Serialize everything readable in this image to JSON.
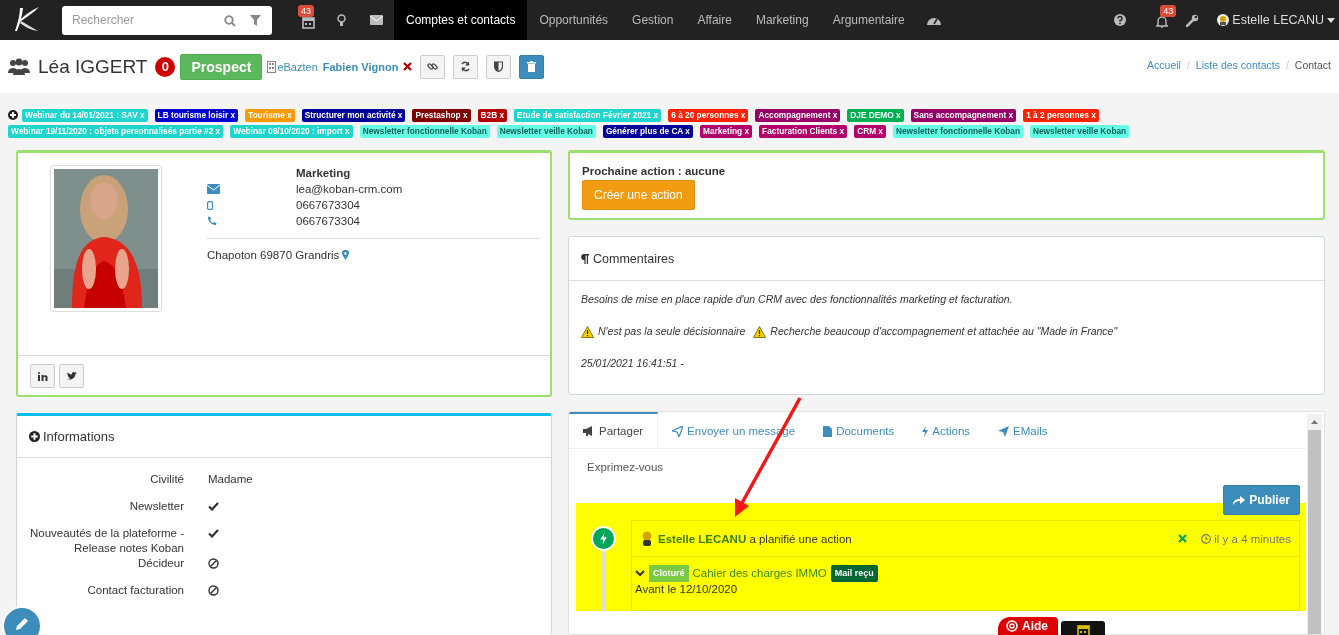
{
  "topbar": {
    "search_placeholder": "Rechercher",
    "calendar_badge": "43",
    "nav": [
      {
        "label": "Comptes et contacts",
        "selected": true
      },
      {
        "label": "Opportunités",
        "selected": false
      },
      {
        "label": "Gestion",
        "selected": false
      },
      {
        "label": "Affaire",
        "selected": false
      },
      {
        "label": "Marketing",
        "selected": false
      },
      {
        "label": "Argumentaire",
        "selected": false
      }
    ],
    "notifications_badge": "43",
    "user": "Estelle LECANU"
  },
  "contact": {
    "name": "Léa IGGERT",
    "score": "0",
    "status": "Prospect",
    "company": "eBazten",
    "owner": "Fabien Vignon"
  },
  "breadcrumb": [
    "Accueil",
    "Liste des contacts",
    "Contact"
  ],
  "breadcrumb_separator": "/",
  "tag_rows": [
    [
      {
        "label": "Webinar du 14/01/2021 : SAV x",
        "color": "#1ed6cb"
      },
      {
        "label": "LB tourisme loisir x",
        "color": "#0000cc"
      },
      {
        "label": "Tourisme x",
        "color": "#ff9900"
      },
      {
        "label": "Structurer mon activité x",
        "color": "#000099"
      },
      {
        "label": "Prestashop x",
        "color": "#800000"
      },
      {
        "label": "B2B x",
        "color": "#b30000"
      },
      {
        "label": "Etude de satisfaction Février 2021 x",
        "color": "#1ed6cb"
      },
      {
        "label": "6 à 20 personnes x",
        "color": "#ff2200"
      },
      {
        "label": "Accompagnement x",
        "color": "#990066"
      },
      {
        "label": "DJE DEMO x",
        "color": "#00b050"
      },
      {
        "label": "Sans accompagnement x",
        "color": "#990066"
      },
      {
        "label": "1 à 2 personnes x",
        "color": "#ff2200"
      }
    ],
    [
      {
        "label": "Webinar 19/11/2020 : objets personnalisés partie #2 x",
        "color": "#1ed6cb"
      },
      {
        "label": "Webinar 08/10/2020 : import x",
        "color": "#1ed6cb"
      },
      {
        "label": "Newsletter fonctionnelle Koban",
        "color": "#66ffe6"
      },
      {
        "label": "Newsletter veille Koban",
        "color": "#66ffe6"
      },
      {
        "label": "Générer plus de CA x",
        "color": "#000099"
      },
      {
        "label": "Marketing x",
        "color": "#b3006b"
      },
      {
        "label": "Facturation Clients x",
        "color": "#b3006b"
      },
      {
        "label": "CRM x",
        "color": "#b3006b"
      },
      {
        "label": "Newsletter fonctionnelle Koban",
        "color": "#66ffe6"
      },
      {
        "label": "Newsletter veille Koban",
        "color": "#66ffe6"
      }
    ]
  ],
  "profile": {
    "job": "Marketing",
    "email": "lea@koban-crm.com",
    "mobile": "0667673304",
    "phone": "0667673304",
    "address": "Chapoton 69870 Grandris"
  },
  "informations": {
    "title": "Informations",
    "fields": [
      {
        "label": "Civilité",
        "kind": "text",
        "value": "Madame"
      },
      {
        "label": "Newsletter",
        "kind": "bool",
        "checked": true
      },
      {
        "label": "Nouveautés de la plateforme - Release notes Koban",
        "kind": "bool",
        "checked": true
      },
      {
        "label": "Décideur",
        "kind": "bool",
        "checked": false
      },
      {
        "label": "Contact facturation",
        "kind": "bool",
        "checked": false
      }
    ]
  },
  "next_action": {
    "label": "Prochaine action : aucune",
    "button": "Créer une action"
  },
  "comments": {
    "title": "Commentaires",
    "text": "Besoins de mise en place rapide d'un CRM avec des fonctionnalités marketing et facturation.",
    "warnings": [
      "N'est pas la seule décisionnaire",
      "Recherche beaucoup d'accompagnement et attachée au \"Made in France\""
    ],
    "date": "25/01/2021 16:41:51 -"
  },
  "activity": {
    "tabs": [
      {
        "label": "Partager",
        "selected": true
      },
      {
        "label": "Envoyer un message",
        "selected": false
      },
      {
        "label": "Documents",
        "selected": false
      },
      {
        "label": "Actions",
        "selected": false
      },
      {
        "label": "EMails",
        "selected": false
      }
    ],
    "placeholder": "Exprimez-vous",
    "publish": "Publier",
    "feed": [
      {
        "author": "Estelle LECANU",
        "verb": "a planifié une action",
        "time": "il y a 4 minutes",
        "status": "Cloturé",
        "title": "Cahier des charges IMMO",
        "tag": "Mail reçu",
        "due": "Avant le 12/10/2020"
      }
    ]
  },
  "help_button": "Aide"
}
